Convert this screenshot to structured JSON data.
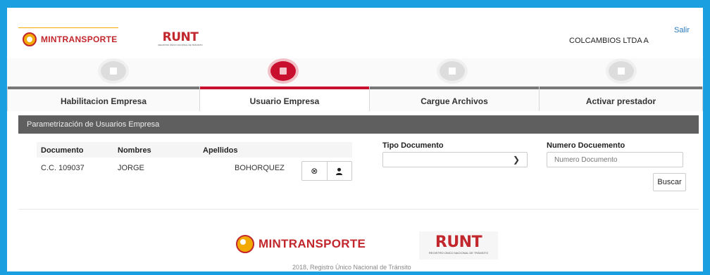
{
  "header": {
    "brand_mintransporte": "MINTRANSPORTE",
    "brand_runt": "RUNT",
    "runt_subtitle": "REGISTRO ÚNICO NACIONAL DE TRÁNSITO",
    "company": "COLCAMBIOS LTDA A",
    "logout_link": "Salir"
  },
  "wizard": {
    "tabs": [
      {
        "label": "Habilitacion Empresa",
        "active": false
      },
      {
        "label": "Usuario Empresa",
        "active": true
      },
      {
        "label": "Cargue Archivos",
        "active": false
      },
      {
        "label": "Activar prestador",
        "active": false
      }
    ]
  },
  "panel": {
    "title": "Parametrización de Usuarios Empresa"
  },
  "table": {
    "columns": [
      "Documento",
      "Nombres",
      "Apellidos"
    ],
    "rows": [
      {
        "documento": "C.C. 109037",
        "nombres": "JORGE",
        "apellidos": "BOHORQUEZ"
      }
    ],
    "actions": {
      "remove_icon": "⊗",
      "user_icon": "user-icon"
    }
  },
  "search": {
    "tipo_label": "Tipo Documento",
    "tipo_value": "",
    "numero_label": "Numero Docuemento",
    "numero_placeholder": "Numero Documento",
    "button": "Buscar"
  },
  "footer": {
    "brand_mintransporte": "MINTRANSPORTE",
    "brand_runt": "RUNT",
    "runt_subtitle": "REGISTRO ÚNICO NACIONAL DE TRÁNSITO",
    "copyright": "2018, Registro Único Nacional de Tránsito"
  },
  "colors": {
    "accent": "#c8102e",
    "frame": "#1a9fe0",
    "panel_header": "#5f5f5f"
  }
}
